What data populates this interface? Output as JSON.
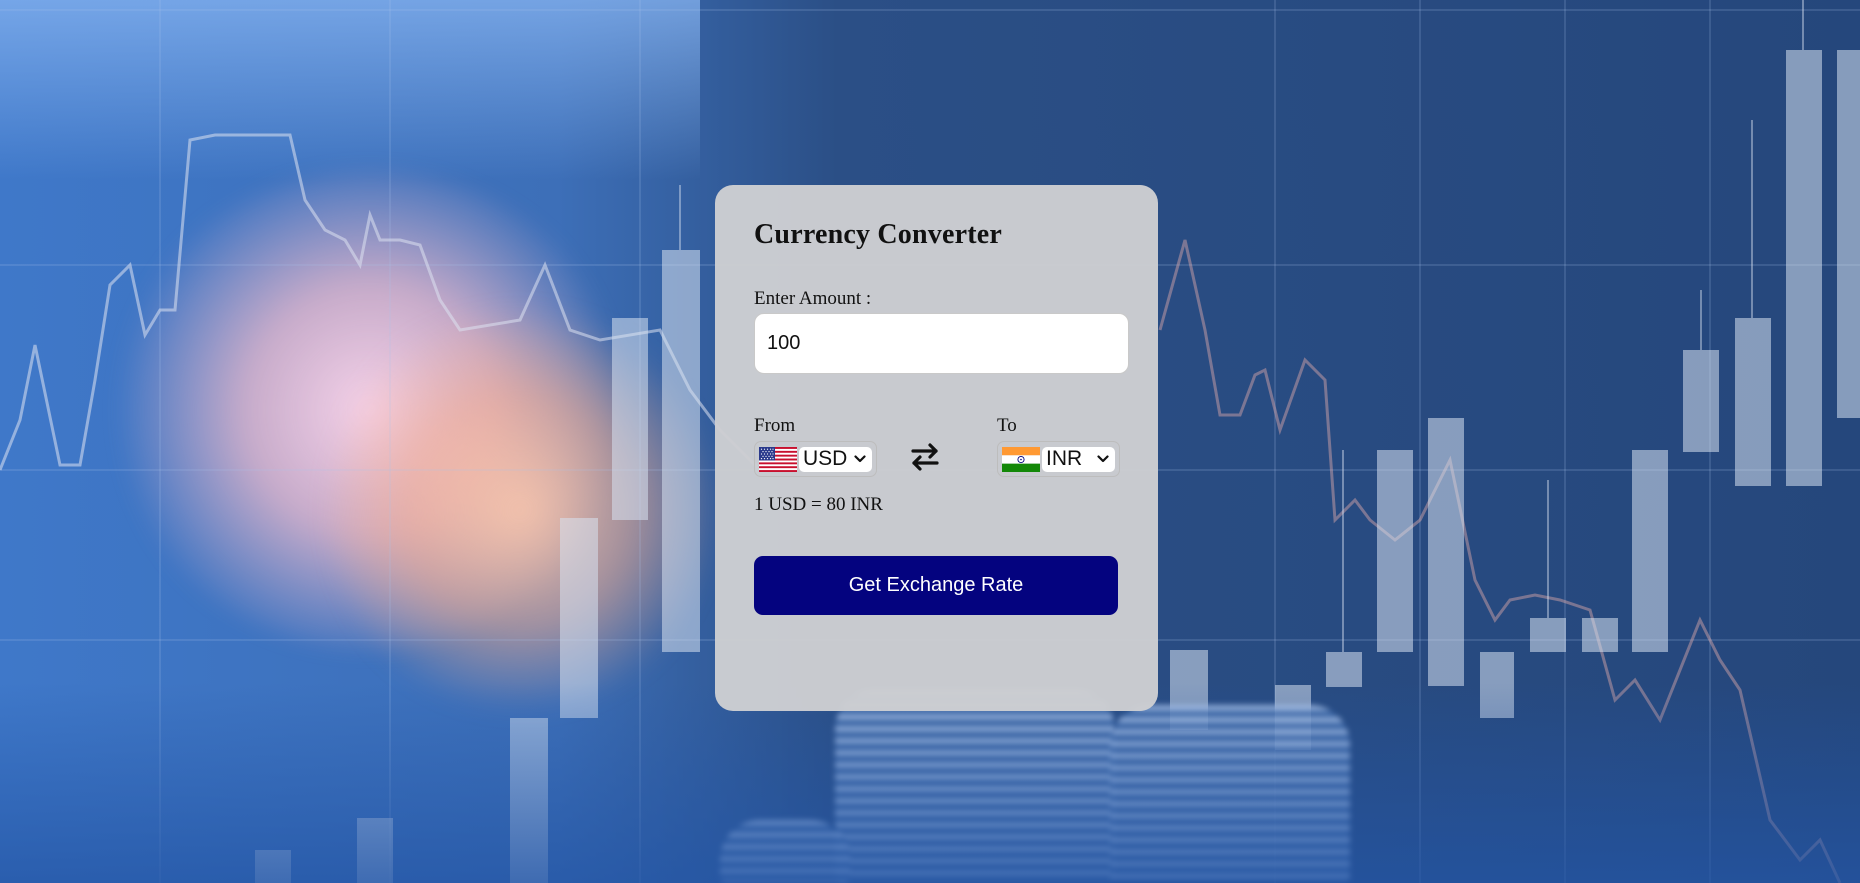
{
  "converter": {
    "title": "Currency Converter",
    "amount_label": "Enter Amount :",
    "amount_value": "100",
    "from_label": "From",
    "to_label": "To",
    "from_currency": "USD",
    "to_currency": "INR",
    "rate_text": "1 USD = 80 INR",
    "button_label": "Get Exchange Rate",
    "button_color": "#04037f",
    "card_color": "#cdced2"
  },
  "icons": {
    "swap": "exchange-arrows-icon",
    "from_flag": "us-flag-icon",
    "to_flag": "india-flag-icon",
    "dropdown": "chevron-down-icon"
  }
}
